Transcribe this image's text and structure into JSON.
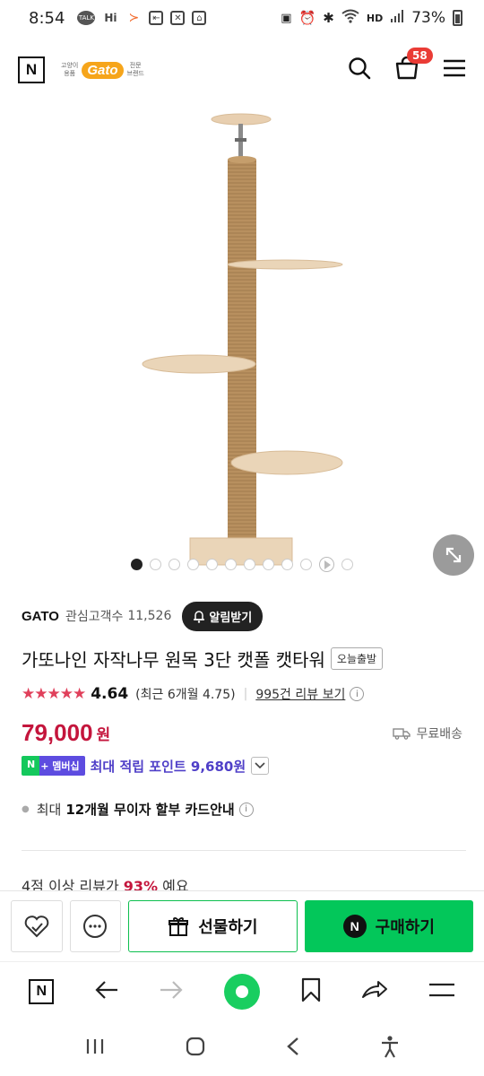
{
  "status_bar": {
    "time": "8:54",
    "battery": "73%",
    "network": "HD"
  },
  "header": {
    "brand_small_left": "고양이\n용품",
    "brand_logo": "Gato",
    "brand_small_right": "전문\n브랜드",
    "cart_count": "58"
  },
  "gallery": {
    "image_count": 12,
    "active_index": 0
  },
  "store": {
    "name": "GATO",
    "fav_label": "관심고객수",
    "fav_count": "11,526",
    "alarm_label": "알림받기"
  },
  "product": {
    "title": "가또나인 자작나무 원목 3단 캣폴 캣타워",
    "badge": "오늘출발",
    "stars": "★★★★★",
    "rating": "4.64",
    "recent_rating": "(최근 6개월 4.75)",
    "reviews": "995건 리뷰 보기",
    "price": "79,000",
    "currency": "원",
    "shipping": "무료배송",
    "nplus_n": "N",
    "nplus_label": "+  멤버십",
    "point_text": "최대 적립 포인트 9,680원",
    "card_prefix": "최대",
    "card_bold": "12개월 무이자 할부 카드안내",
    "partial_prefix": "4점 이상 리뷰가",
    "partial_pct": "93%",
    "partial_suffix": "예요"
  },
  "buy_bar": {
    "gift_label": "선물하기",
    "buy_label": "구매하기",
    "buy_icon": "N"
  },
  "browser_toolbar": {
    "n_label": "N"
  },
  "colors": {
    "price_red": "#c4153c",
    "naver_green": "#03c75a",
    "point_purple": "#4f3fc8",
    "star_red": "#e0405b"
  }
}
